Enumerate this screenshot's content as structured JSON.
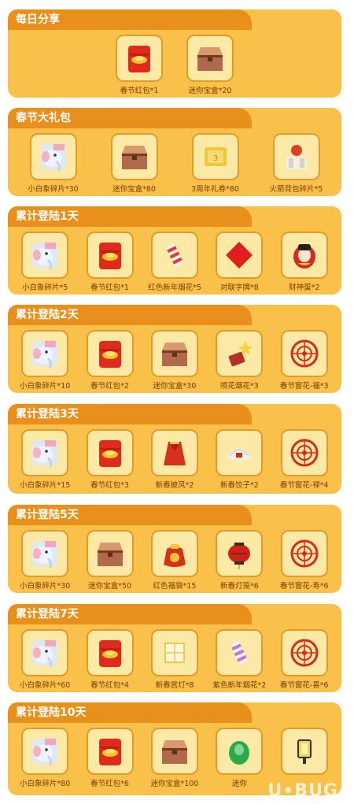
{
  "watermark": "U•BUG",
  "sections": [
    {
      "title": "每日分享",
      "items": [
        {
          "label": "春节红包*1",
          "icon": "red-envelope"
        },
        {
          "label": "迷你宝盒*20",
          "icon": "treasure-box"
        }
      ]
    },
    {
      "title": "春节大礼包",
      "items": [
        {
          "label": "小白象碎片*30",
          "icon": "elephant"
        },
        {
          "label": "迷你宝盒*80",
          "icon": "treasure-box"
        },
        {
          "label": "3周年礼券*80",
          "icon": "coupon"
        },
        {
          "label": "火箭背包碎片*5",
          "icon": "rocket-pack"
        }
      ]
    },
    {
      "title": "累计登陆1天",
      "items": [
        {
          "label": "小白象碎片*5",
          "icon": "elephant"
        },
        {
          "label": "春节红包*1",
          "icon": "red-envelope"
        },
        {
          "label": "红色新年烟花*5",
          "icon": "firework-red"
        },
        {
          "label": "对联字牌*8",
          "icon": "couplet-card"
        },
        {
          "label": "财神蛋*2",
          "icon": "fortune-egg"
        }
      ]
    },
    {
      "title": "累计登陆2天",
      "items": [
        {
          "label": "小白象碎片*10",
          "icon": "elephant"
        },
        {
          "label": "春节红包*2",
          "icon": "red-envelope"
        },
        {
          "label": "迷你宝盒*30",
          "icon": "treasure-box"
        },
        {
          "label": "喷花烟花*3",
          "icon": "spray-firework"
        },
        {
          "label": "春节窗花-福*3",
          "icon": "window-flower"
        }
      ]
    },
    {
      "title": "累计登陆3天",
      "items": [
        {
          "label": "小白象碎片*15",
          "icon": "elephant"
        },
        {
          "label": "春节红包*3",
          "icon": "red-envelope"
        },
        {
          "label": "新春披风*2",
          "icon": "cape"
        },
        {
          "label": "新春饺子*2",
          "icon": "dumpling"
        },
        {
          "label": "春节窗花-禄*4",
          "icon": "window-flower"
        }
      ]
    },
    {
      "title": "累计登陆5天",
      "items": [
        {
          "label": "小白象碎片*30",
          "icon": "elephant"
        },
        {
          "label": "迷你宝盒*50",
          "icon": "treasure-box"
        },
        {
          "label": "红色福袋*15",
          "icon": "lucky-bag"
        },
        {
          "label": "新春灯笼*6",
          "icon": "lantern"
        },
        {
          "label": "春节窗花-寿*6",
          "icon": "window-flower"
        }
      ]
    },
    {
      "title": "累计登陆7天",
      "items": [
        {
          "label": "小白象碎片*60",
          "icon": "elephant"
        },
        {
          "label": "春节红包*4",
          "icon": "red-envelope"
        },
        {
          "label": "新春宫灯*8",
          "icon": "palace-lamp"
        },
        {
          "label": "紫色新年烟花*2",
          "icon": "firework-purple"
        },
        {
          "label": "春节窗花-喜*6",
          "icon": "window-flower"
        }
      ]
    },
    {
      "title": "累计登陆10天",
      "items": [
        {
          "label": "小白象碎片*80",
          "icon": "elephant"
        },
        {
          "label": "春节红包*6",
          "icon": "red-envelope"
        },
        {
          "label": "迷你宝盒*100",
          "icon": "treasure-box"
        },
        {
          "label": "迷你",
          "icon": "green-egg"
        },
        {
          "label": "",
          "icon": "lamp-post"
        }
      ]
    }
  ]
}
